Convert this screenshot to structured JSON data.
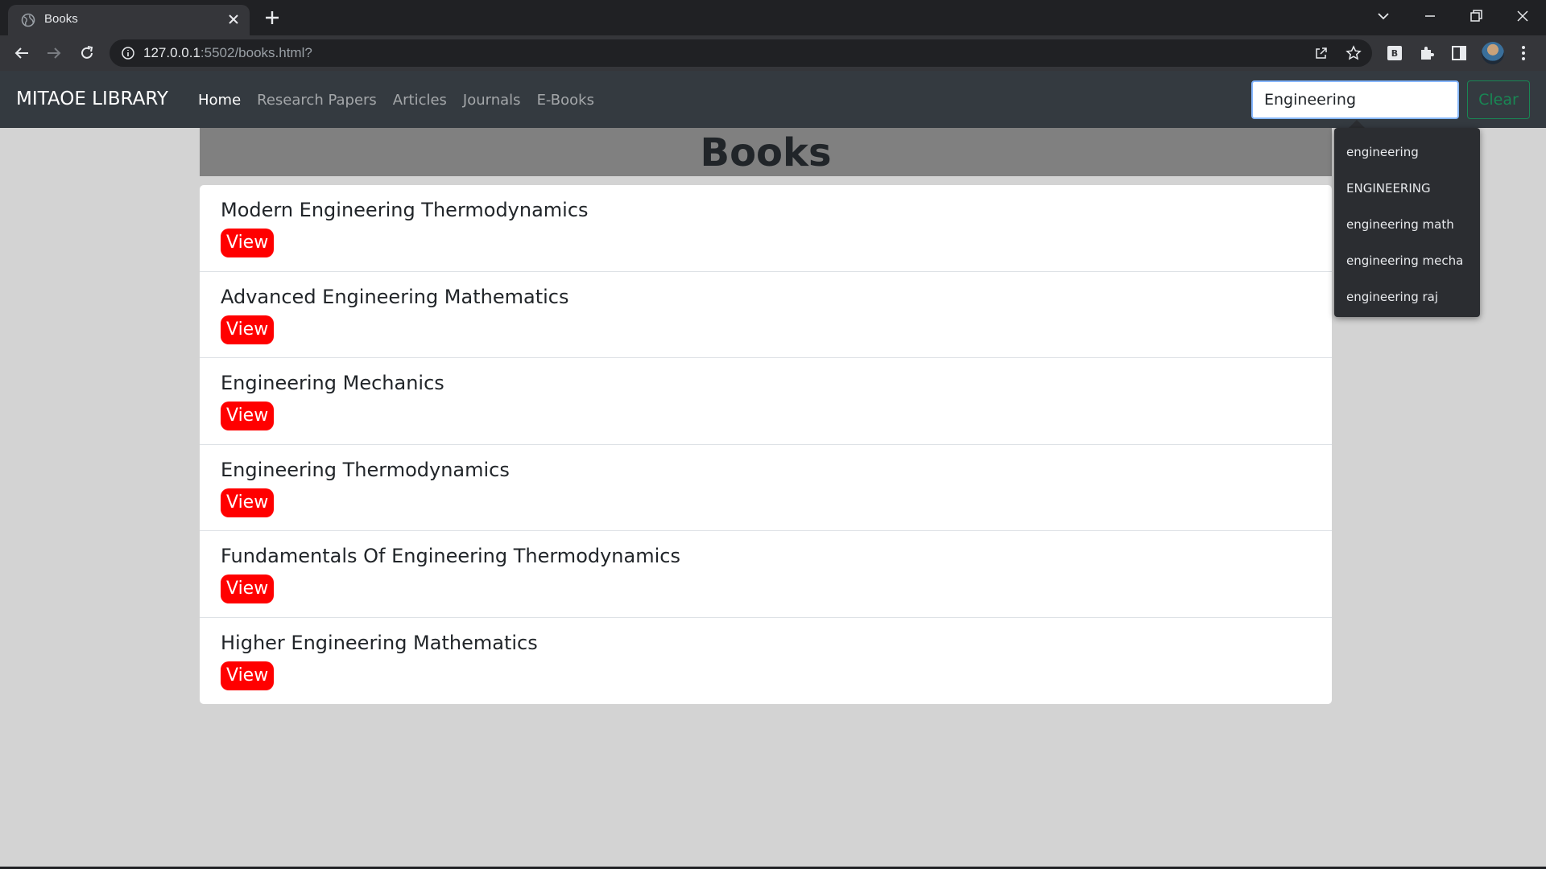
{
  "browser": {
    "tab_title": "Books",
    "url_host": "127.0.0.1",
    "url_path": ":5502/books.html?"
  },
  "navbar": {
    "brand": "MITAOE LIBRARY",
    "links": [
      {
        "label": "Home",
        "active": true
      },
      {
        "label": "Research Papers",
        "active": false
      },
      {
        "label": "Articles",
        "active": false
      },
      {
        "label": "Journals",
        "active": false
      },
      {
        "label": "E-Books",
        "active": false
      }
    ],
    "search_value": "Engineering",
    "clear_label": "Clear"
  },
  "main": {
    "heading": "Books",
    "view_label": "View",
    "books": [
      "Modern Engineering Thermodynamics",
      "Advanced Engineering Mathematics",
      "Engineering Mechanics",
      "Engineering Thermodynamics",
      "Fundamentals Of Engineering Thermodynamics",
      "Higher Engineering Mathematics"
    ]
  },
  "suggestions": [
    "engineering",
    "ENGINEERING",
    "engineering math",
    "engineering mecha",
    "engineering raj"
  ],
  "colors": {
    "navbar_bg": "#343a40",
    "page_bg": "#d3d3d3",
    "view_button": "#ff0000",
    "clear_button": "#198754"
  }
}
